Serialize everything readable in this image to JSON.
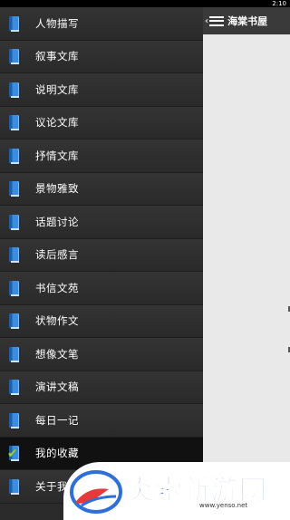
{
  "status_bar": {
    "time": "2:10"
  },
  "app_bar": {
    "title": "海棠书屋",
    "back_glyph": "‹"
  },
  "drawer": {
    "items": [
      {
        "label": "人物描写",
        "icon": "book-icon"
      },
      {
        "label": "叙事文库",
        "icon": "book-icon"
      },
      {
        "label": "说明文库",
        "icon": "book-icon"
      },
      {
        "label": "议论文库",
        "icon": "book-icon"
      },
      {
        "label": "抒情文库",
        "icon": "book-icon"
      },
      {
        "label": "景物雅致",
        "icon": "book-icon"
      },
      {
        "label": "话题讨论",
        "icon": "book-icon"
      },
      {
        "label": "读后感言",
        "icon": "book-icon"
      },
      {
        "label": "书信文苑",
        "icon": "book-icon"
      },
      {
        "label": "状物作文",
        "icon": "book-icon"
      },
      {
        "label": "想像文笔",
        "icon": "book-icon"
      },
      {
        "label": "演讲文稿",
        "icon": "book-icon"
      },
      {
        "label": "每日一记",
        "icon": "book-icon"
      },
      {
        "label": "我的收藏",
        "icon": "book-check-icon"
      },
      {
        "label": "关于我",
        "icon": "book-icon"
      }
    ]
  },
  "watermark": {
    "text": "炎索新游网",
    "url": "www.yenso.net"
  },
  "colors": {
    "drawer_bg": "#2b2b2b",
    "app_bar_bg": "#3a3a3a",
    "book_blue": "#3a8de0",
    "check_green": "#9bd23a"
  }
}
